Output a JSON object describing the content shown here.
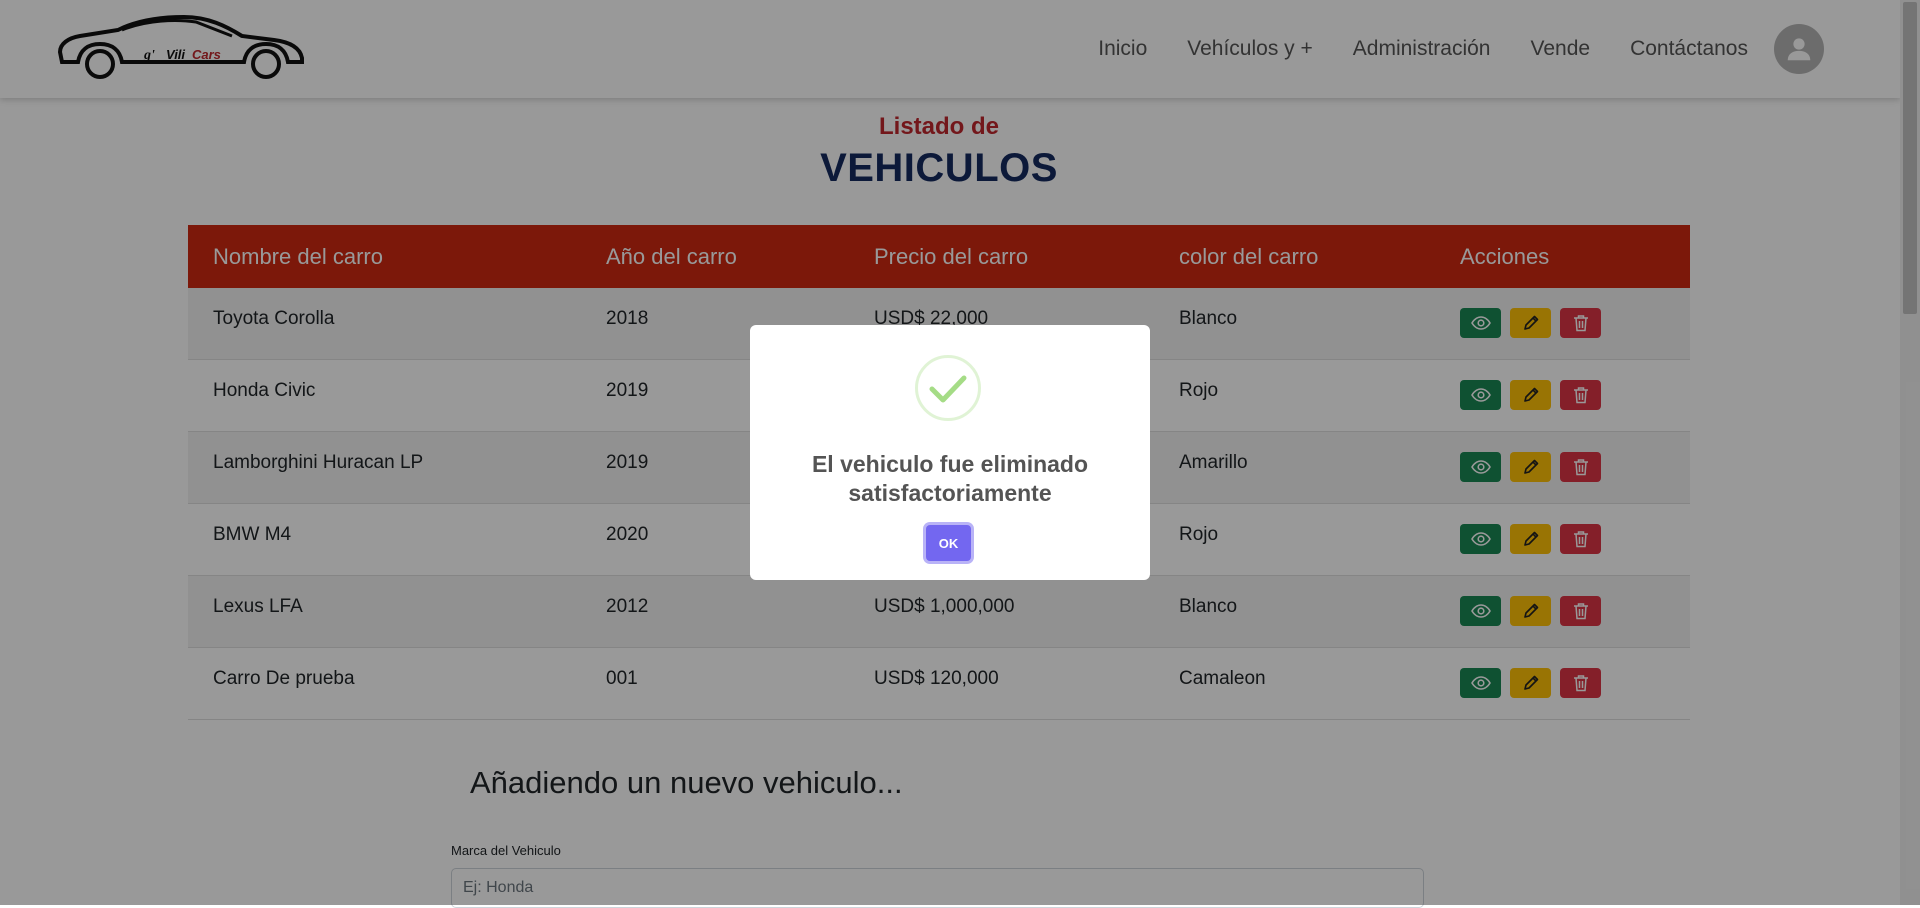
{
  "navbar": {
    "logo_text": "g' ViliCars",
    "links": [
      "Inicio",
      "Vehículos y +",
      "Administración",
      "Vende",
      "Contáctanos"
    ]
  },
  "header": {
    "subtitle": "Listado de",
    "title": "VEHICULOS"
  },
  "table": {
    "columns": [
      "Nombre del carro",
      "Año del carro",
      "Precio del carro",
      "color del carro",
      "Acciones"
    ],
    "rows": [
      {
        "name": "Toyota Corolla",
        "year": "2018",
        "price": "USD$ 22,000",
        "color": "Blanco"
      },
      {
        "name": "Honda Civic",
        "year": "2019",
        "price": "",
        "color": "Rojo"
      },
      {
        "name": "Lamborghini Huracan LP",
        "year": "2019",
        "price": "",
        "color": "Amarillo"
      },
      {
        "name": "BMW M4",
        "year": "2020",
        "price": "",
        "color": "Rojo"
      },
      {
        "name": "Lexus LFA",
        "year": "2012",
        "price": "USD$ 1,000,000",
        "color": "Blanco"
      },
      {
        "name": "Carro De prueba",
        "year": "001",
        "price": "USD$ 120,000",
        "color": "Camaleon"
      }
    ]
  },
  "form": {
    "heading": "Añadiendo un nuevo vehiculo...",
    "brand_label": "Marca del Vehiculo",
    "brand_placeholder": "Ej: Honda"
  },
  "modal": {
    "title": "El vehiculo fue eliminado satisfactoriamente",
    "ok_label": "OK"
  },
  "colors": {
    "header_red": "#cf2811",
    "title_navy": "#142a5f",
    "subtitle_red": "#c0272d",
    "view_green": "#198754",
    "edit_yellow": "#ffc107",
    "delete_red": "#dc3545",
    "ok_purple": "#7367f0",
    "success_green": "#a5dc86"
  }
}
